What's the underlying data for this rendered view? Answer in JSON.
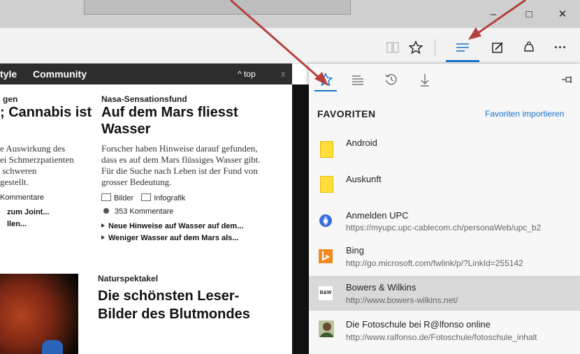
{
  "window": {
    "minimize": "–",
    "maximize": "□",
    "close": "✕"
  },
  "toolbar": {
    "reading_view_icon": "book-icon",
    "favorite_icon": "star-icon",
    "hub_icon": "hub-icon",
    "note_icon": "note-icon",
    "share_icon": "share-icon",
    "more": "···"
  },
  "page": {
    "nav": {
      "style": "tyle",
      "community": "Community",
      "top": "^ top",
      "close": "x"
    },
    "left_col": {
      "kicker": "gen",
      "headline": "; Cannabis ist",
      "lines": [
        "e Auswirkung des",
        "ei Schmerzpatienten",
        " schweren",
        "gestellt."
      ],
      "comments": "Kommentare",
      "related": [
        "zum Joint...",
        "llen..."
      ]
    },
    "article1": {
      "kicker": "Nasa-Sensationsfund",
      "headline_line1": "Auf dem Mars fliesst",
      "headline_line2": "Wasser",
      "lines": [
        "Forscher haben Hinweise darauf gefunden,",
        "dass es auf dem Mars flüssiges Wasser gibt.",
        "Für die Suche nach Leben ist der Fund von",
        "grosser Bedeutung."
      ],
      "media_bilder": "Bilder",
      "media_infografik": "Infografik",
      "comments": "353 Kommentare",
      "related": [
        "Neue Hinweise auf Wasser auf dem...",
        "Weniger Wasser auf dem Mars als..."
      ]
    },
    "article2": {
      "kicker": "Naturspektakel",
      "headline_line1": "Die schönsten Leser-",
      "headline_line2": "Bilder des Blutmondes"
    }
  },
  "hub": {
    "tabs": {
      "favorites": "☆",
      "reading_list": "≣",
      "history": "↺",
      "downloads": "↓",
      "pin": "⊣⊢"
    },
    "title": "FAVORITEN",
    "import_link": "Favoriten importieren",
    "items": [
      {
        "name": "Android",
        "url": "",
        "icon": "folder-icon"
      },
      {
        "name": "Auskunft",
        "url": "",
        "icon": "folder-icon"
      },
      {
        "name": "Anmelden UPC",
        "url": "https://myupc.upc-cablecom.ch/personaWeb/upc_b2",
        "icon": "upc-icon"
      },
      {
        "name": "Bing",
        "url": "http://go.microsoft.com/fwlink/p/?LinkId=255142",
        "icon": "bing-icon"
      },
      {
        "name": "Bowers & Wilkins",
        "url": "http://www.bowers-wilkins.net/",
        "icon": "bw-icon",
        "badge": "B&W"
      },
      {
        "name": "Die Fotoschule bei R@lfonso online",
        "url": "http://www.ralfonso.de/Fotoschule/fotoschule_inhalt",
        "icon": "person-icon"
      }
    ]
  },
  "colors": {
    "accent": "#1a73c9",
    "arrow": "#b5413c",
    "bing": "#f2891d",
    "folder": "#ffde3b"
  }
}
